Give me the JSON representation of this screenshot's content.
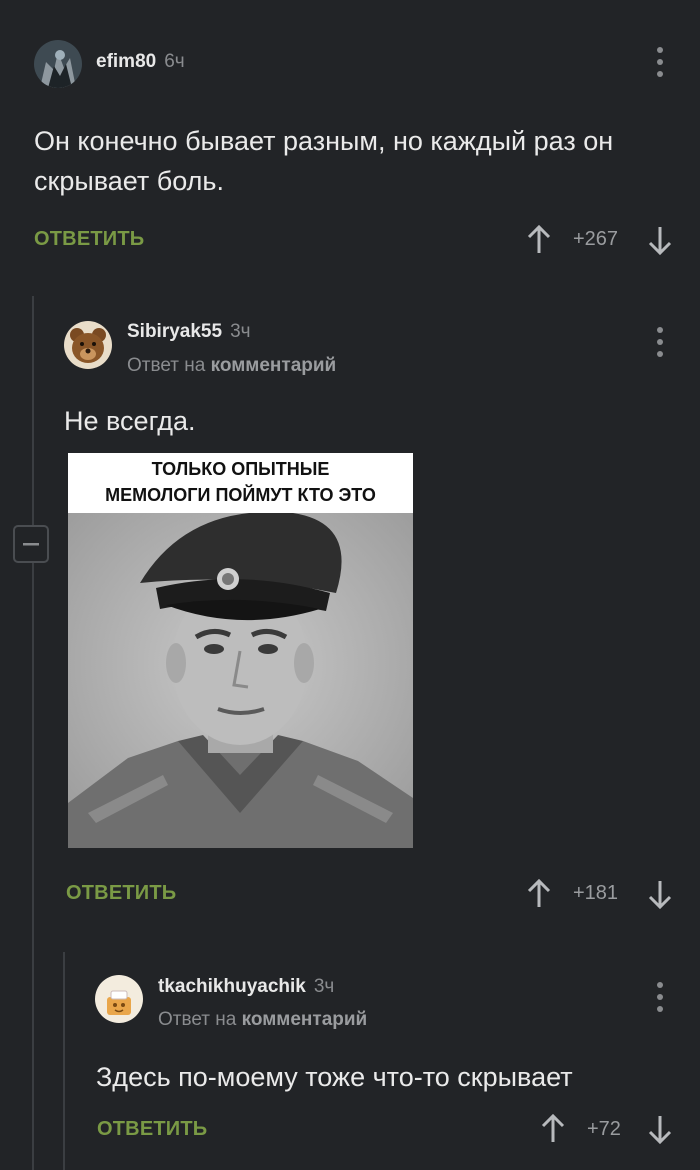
{
  "comments": [
    {
      "username": "efim80",
      "time": "6ч",
      "text": "Он конечно бывает разным, но каждый раз он скрывает боль.",
      "reply_label": "ОТВЕТИТЬ",
      "score": "+267"
    },
    {
      "username": "Sibiryak55",
      "time": "3ч",
      "reply_prefix": "Ответ на",
      "reply_target": "комментарий",
      "text": "Не всегда.",
      "image_caption_line1": "ТОЛЬКО ОПЫТНЫЕ",
      "image_caption_line2": "МЕМОЛОГИ ПОЙМУТ КТО ЭТО",
      "reply_label": "ОТВЕТИТЬ",
      "score": "+181"
    },
    {
      "username": "tkachikhuyachik",
      "time": "3ч",
      "reply_prefix": "Ответ на",
      "reply_target": "комментарий",
      "text": "Здесь по-моему тоже что-то скрывает",
      "reply_label": "ОТВЕТИТЬ",
      "score": "+72"
    }
  ],
  "icons": {
    "upvote": "arrow-up-icon",
    "downvote": "arrow-down-icon",
    "more": "more-vertical-icon",
    "collapse": "minus-icon"
  },
  "colors": {
    "background": "#222427",
    "reply_button": "#7a9a45",
    "muted_text": "#8a8c8f"
  }
}
